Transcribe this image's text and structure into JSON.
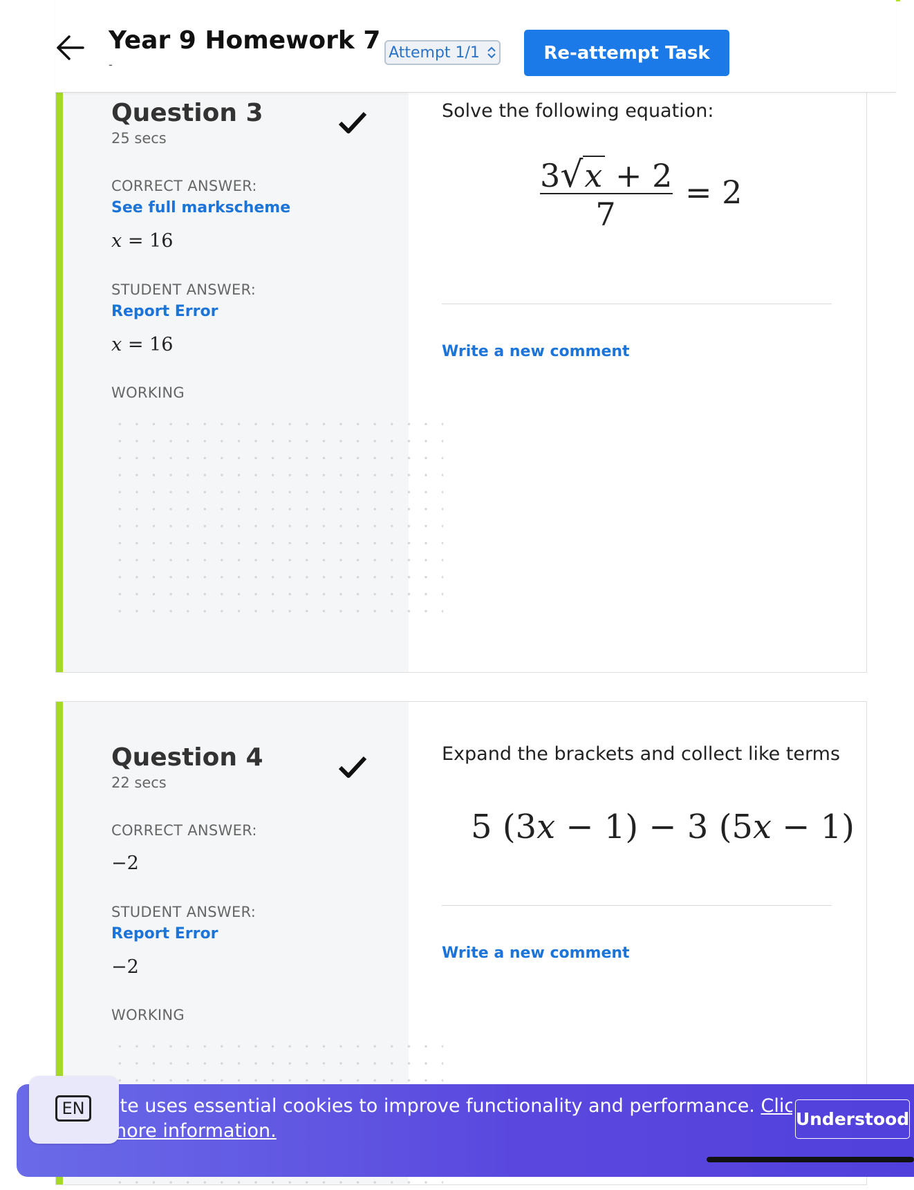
{
  "header": {
    "title": "Year 9 Homework 7",
    "subtitle": "-",
    "attempt_label": "Attempt 1/1",
    "reattempt_label": "Re-attempt Task"
  },
  "questions": [
    {
      "title": "Question 3",
      "time": "25 secs",
      "correct_label": "CORRECT ANSWER:",
      "markscheme_link": "See full markscheme",
      "correct_answer": {
        "var": "x",
        "op": "=",
        "value": "16"
      },
      "student_label": "STUDENT ANSWER:",
      "report_link": "Report Error",
      "student_answer": {
        "var": "x",
        "op": "=",
        "value": "16"
      },
      "working_label": "WORKING",
      "prompt": "Solve the following equation:",
      "equation": {
        "coef": "3",
        "var": "x",
        "plus": "+",
        "const": "2",
        "denominator": "7",
        "equals": "=",
        "rhs": "2"
      },
      "comment_link": "Write a new comment"
    },
    {
      "title": "Question 4",
      "time": "22 secs",
      "correct_label": "CORRECT ANSWER:",
      "correct_answer": "−2",
      "student_label": "STUDENT ANSWER:",
      "report_link": "Report Error",
      "student_answer": "−2",
      "working_label": "WORKING",
      "prompt": "Expand the brackets and collect like terms",
      "equation": {
        "a": "5",
        "b": "(3",
        "var1": "x",
        "c": " − 1) − 3 (5",
        "var2": "x",
        "d": " − 1)"
      },
      "comment_link": "Write a new comment"
    }
  ],
  "cookie": {
    "text": "ite uses essential cookies to improve functionality and performance.",
    "link1": "Click",
    "link2": "nore information.",
    "button": "Understood"
  },
  "language": {
    "code": "EN"
  },
  "colors": {
    "accent": "#a6d82a",
    "link": "#1c74d8",
    "primary_button": "#1c7ae8",
    "banner": "#5a48de"
  }
}
